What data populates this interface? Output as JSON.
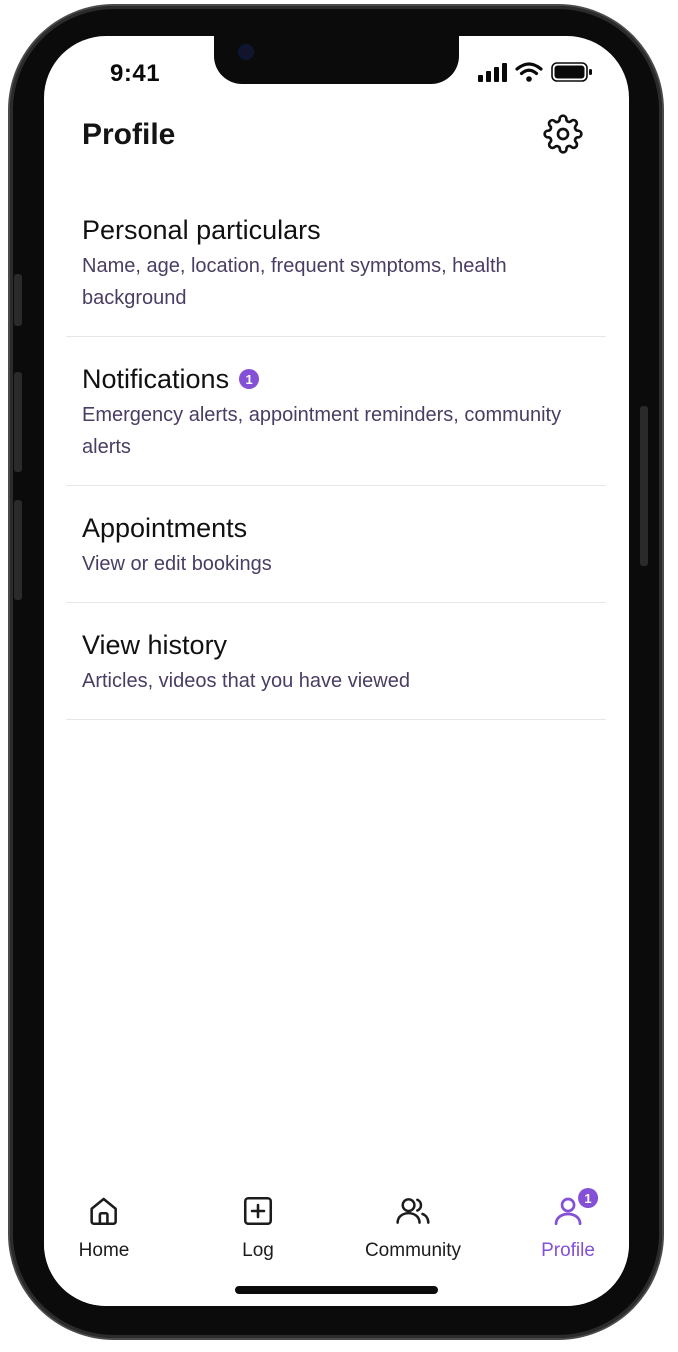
{
  "status_bar": {
    "time": "9:41"
  },
  "header": {
    "title": "Profile",
    "settings_icon": "gear-icon"
  },
  "menu": [
    {
      "title": "Personal particulars",
      "subtitle": "Name, age, location, frequent symptoms, health background",
      "badge": ""
    },
    {
      "title": "Notifications",
      "subtitle": "Emergency alerts, appointment reminders, community alerts",
      "badge": "1"
    },
    {
      "title": "Appointments",
      "subtitle": "View or edit bookings",
      "badge": ""
    },
    {
      "title": "View history",
      "subtitle": "Articles, videos that you have viewed",
      "badge": ""
    }
  ],
  "tabs": [
    {
      "label": "Home",
      "icon": "home-icon",
      "active": false
    },
    {
      "label": "Log",
      "icon": "plus-square-icon",
      "active": false
    },
    {
      "label": "Community",
      "icon": "users-icon",
      "active": false
    },
    {
      "label": "Profile",
      "icon": "user-icon",
      "active": true,
      "badge": "1"
    }
  ],
  "colors": {
    "accent": "#8450d6",
    "text": "#111111",
    "subtext": "#4a3d63"
  }
}
